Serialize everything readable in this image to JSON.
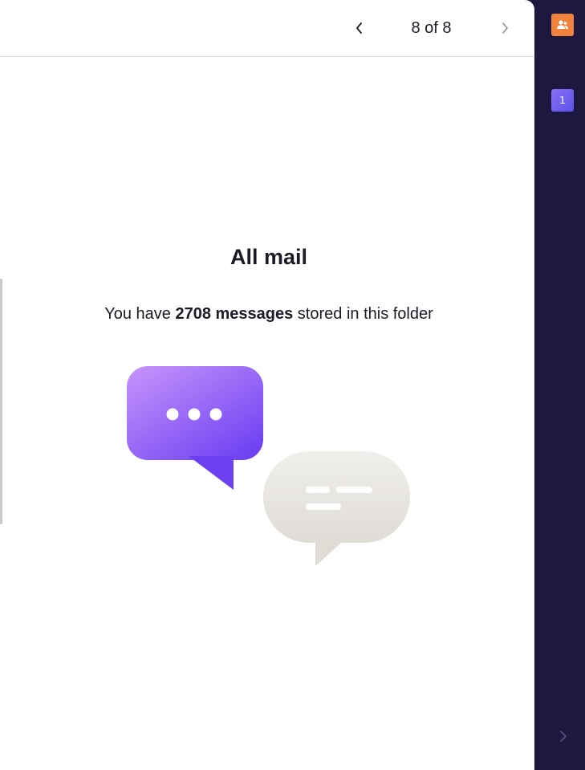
{
  "toolbar": {
    "pager": "8 of 8",
    "prev_icon": "chevron-left-icon",
    "next_icon": "chevron-right-icon"
  },
  "empty_state": {
    "title": "All mail",
    "text_before": "You have ",
    "count_text": "2708 messages",
    "text_after": " stored in this folder",
    "illustration": "chat-bubbles-illustration"
  },
  "rail": {
    "contacts_icon": "contacts-icon",
    "calendar_day": "1",
    "expand_icon": "chevron-right-icon"
  },
  "colors": {
    "sidebar_bg": "#1c1840",
    "accent_purple": "#8a5cf5",
    "contacts_orange": "#f1833d"
  }
}
